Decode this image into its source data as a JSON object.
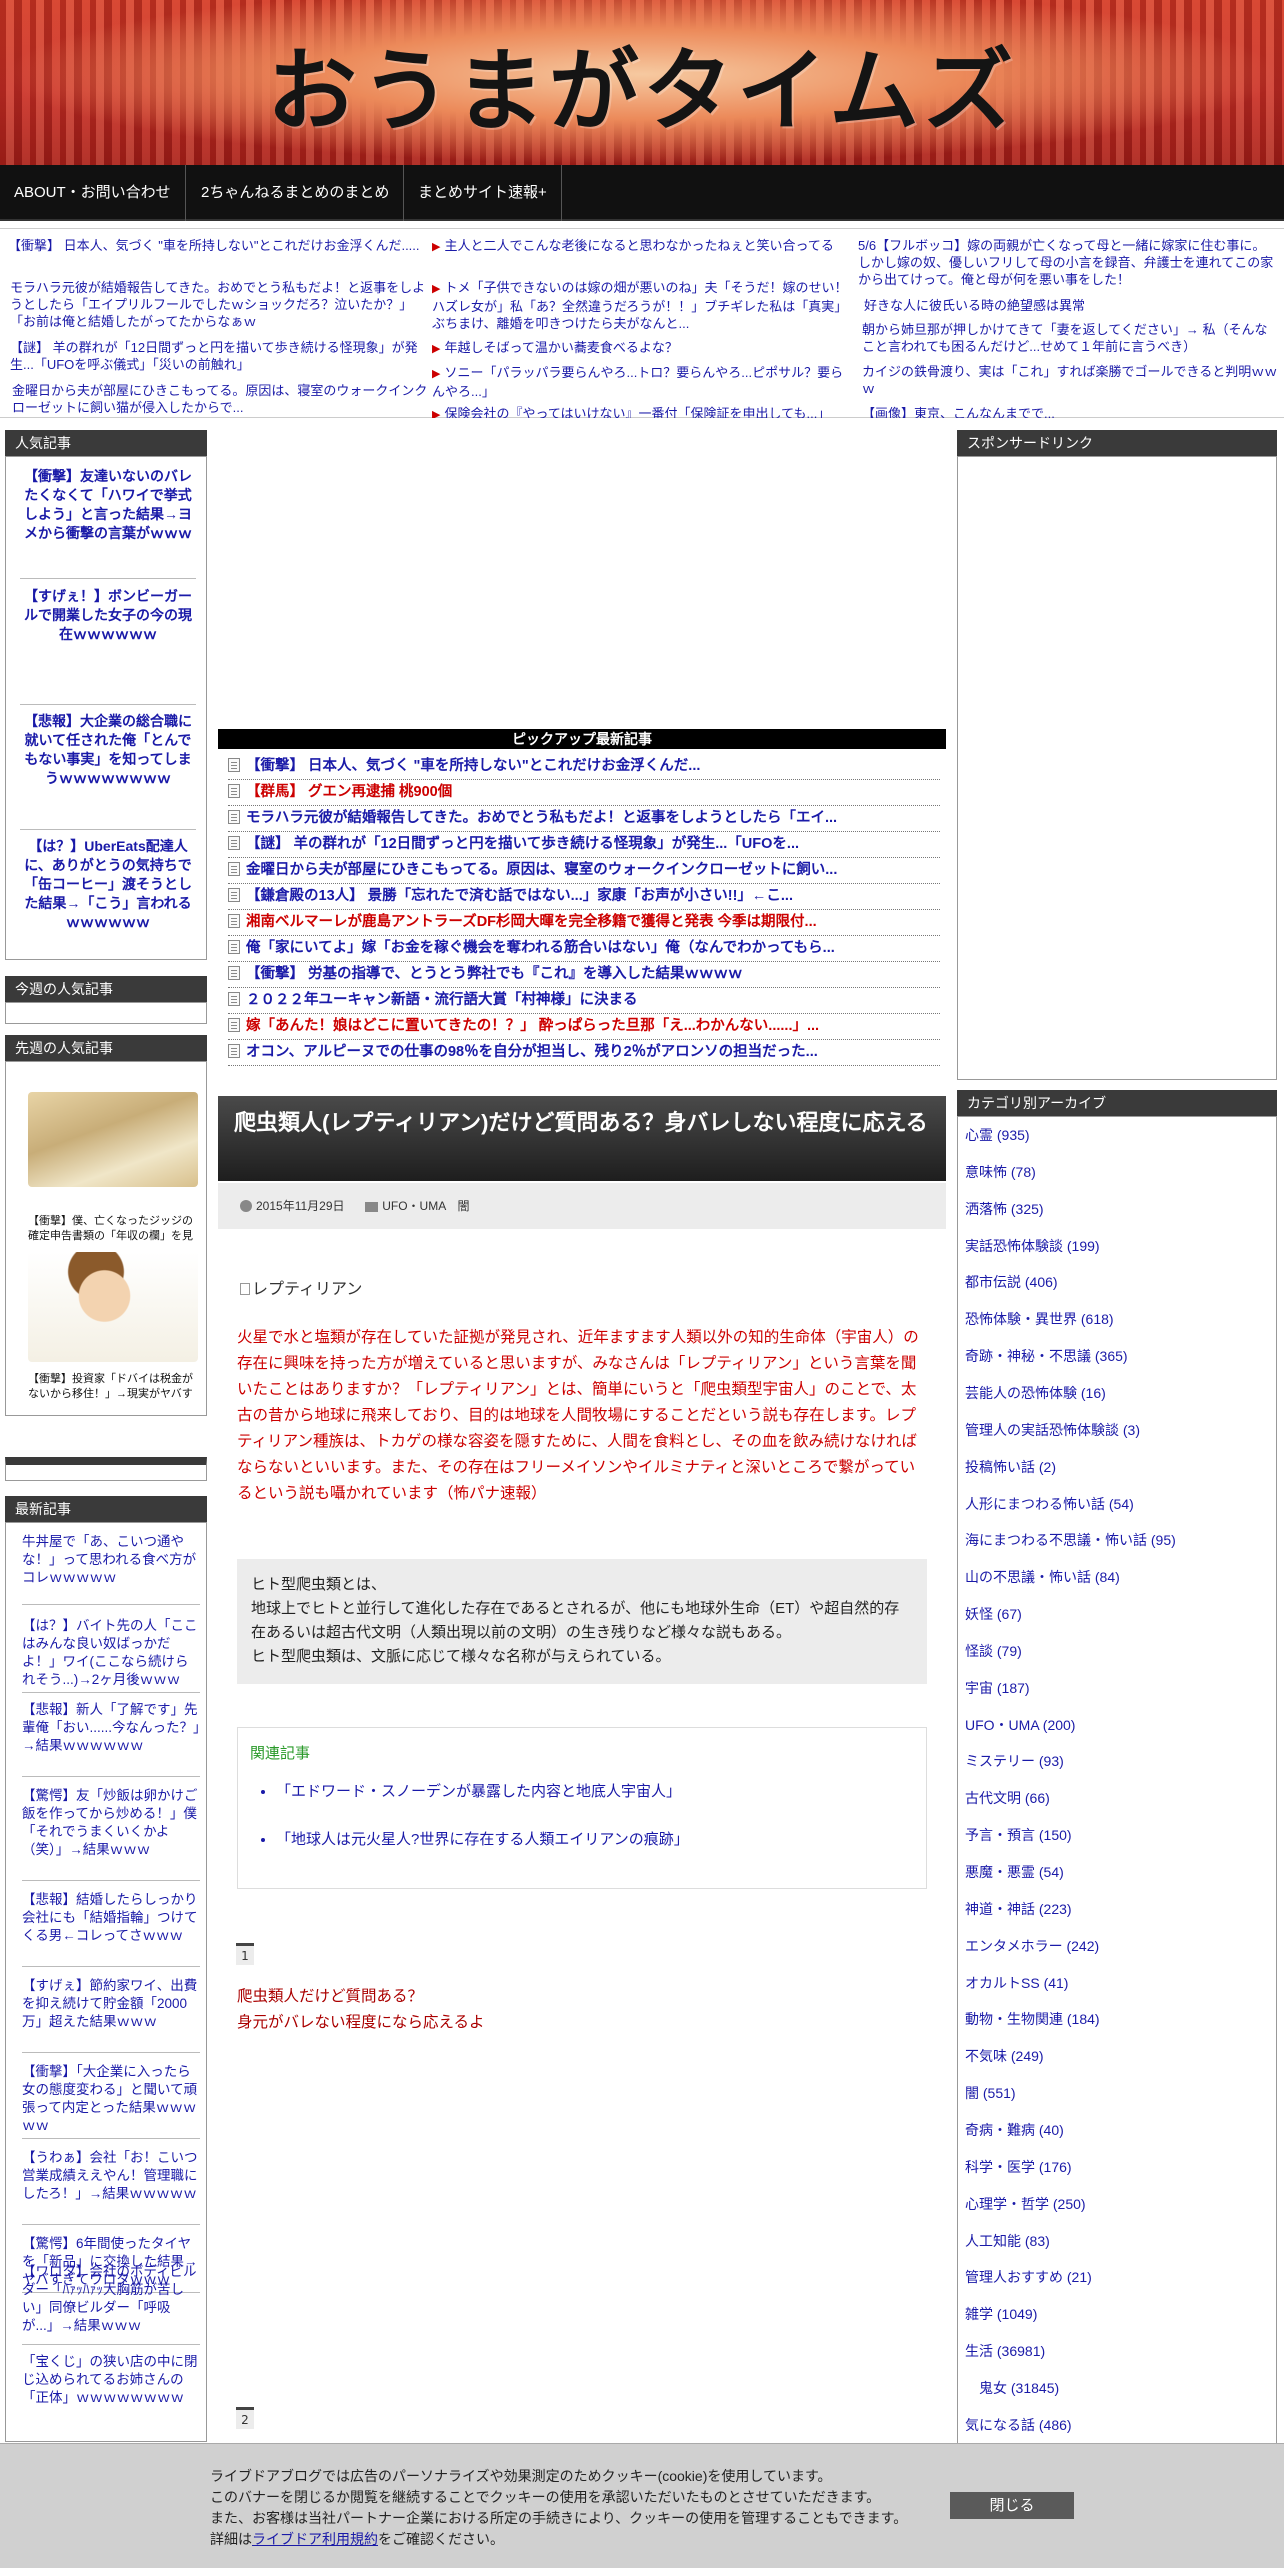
{
  "site": {
    "title": "おうまがタイムズ"
  },
  "nav": [
    "ABOUT・お問い合わせ",
    "2ちゃんねるまとめのまとめ",
    "まとめサイト速報+"
  ],
  "ticker": {
    "col1": [
      "【衝撃】 日本人、気づく \"車を所持しない\"とこれだけお金浮くんだ.....",
      "モラハラ元彼が結婚報告してきた。おめでとう私もだよ！と返事をしようとしたら「エイプリルフールでしたｗショックだろ？泣いたか？」「お前は俺と結婚したがってたからなぁｗ",
      "【謎】 羊の群れが「12日間ずっと円を描いて歩き続ける怪現象」が発生...「UFOを呼ぶ儀式」「災いの前触れ」",
      "金曜日から夫が部屋にひきこもってる。原因は、寝室のウォークインクローゼットに飼い猫が侵入したからで..."
    ],
    "col2": [
      "主人と二人でこんな老後になると思わなかったねぇと笑い合ってる",
      "トメ「子供できないのは嫁の畑が悪いのね」夫「そうだ！嫁のせい！ハズレ女が」私「あ？全然違うだろうが！！」ブチギレた私は「真実」ぶちまけ、離婚を叩きつけたら夫がなんと...",
      "年越しそばって温かい蕎麦食べるよな？",
      "ソニー「パラッパラ要らんやろ...トロ？要らんやろ...ピポサル？要らんやろ...」",
      "保険会社の『やってはいけない』一番付「保険証を申出しても...」"
    ],
    "col3": [
      "5/6【フルボッコ】嫁の両親が亡くなって母と一緒に嫁家に住む事に。しかし嫁の奴、優しいフリして母の小言を録音、弁護士を連れてこの家から出てけって。俺と母が何を悪い事をした！",
      "好きな人に彼氏いる時の絶望感は異常",
      "朝から姉旦那が押しかけてきて「妻を返してください」→ 私（そんなこと言われても困るんだけど...せめて１年前に言うべき）",
      "カイジの鉄骨渡り、実は「これ」すれば楽勝でゴールできると判明ｗｗｗ",
      "【画像】東京、こんなんまでで..."
    ]
  },
  "left": {
    "popular_head": "人気記事",
    "popular": [
      "【衝撃】友達いないのバレたくなくて「ハワイで挙式しよう」と言った結果→ヨメから衝撃の言葉がｗｗｗ",
      "【すげぇ！】ボンビーガールで開業した女子の今の現在ｗｗｗｗｗｗ",
      "【悲報】大企業の総合職に就いて任された俺「とんでもない事実」を知ってしまうｗｗｗｗｗｗｗｗ",
      "【は？】UberEats配達人に、ありがとうの気持ちで「缶コーヒー」渡そうとした結果→「こう」言われるｗｗｗｗｗｗ"
    ],
    "weekly_head": "今週の人気記事",
    "lastweek_head": "先週の人気記事",
    "lastweek": [
      "【衝撃】僕、亡くなったジッジの確定申告書類の「年収の欄」を見てしまった結果ｗｗｗ",
      "【衝撃】投資家「ドバイは税金がないから移住！」→現実がヤバすぎる・・・"
    ],
    "latest_head": "最新記事",
    "latest": [
      "牛丼屋で「あ、こいつ通やな！」って思われる食べ方がコレｗｗｗｗｗ",
      "【は？】バイト先の人「ここはみんな良い奴ばっかだよ！」ワイ(ここなら続けられそう...)→2ヶ月後ｗｗｗ",
      "【悲報】新人「了解です」先輩俺「おい......今なんった？」→結果ｗｗｗｗｗｗ",
      "【驚愕】友「炒飯は卵かけご飯を作ってから炒める！」僕「それでうまくいくかよ（笑）」→結果ｗｗｗ",
      "【悲報】結婚したらしっかり会社にも「結婚指輪」つけてくる男←コレってさｗｗｗ",
      "【すげぇ】節約家ワイ、出費を抑え続けて貯金額「2000万」超えた結果ｗｗｗ",
      "【衝撃】「大企業に入ったら女の態度変わる」と聞いて頑張って内定とった結果ｗｗｗｗｗ",
      "【うわぁ】会社「お！こいつ営業成績ええやん！管理職にしたろ！」→結果ｗｗｗｗｗ",
      "【驚愕】6年間使ったタイヤを「新品」に交換した結果→ヤバすぎてワロタｗｗｗ",
      "【ワロタ】会社のボディビルダー「ﾊｧｯﾊｧｯ大胸筋が苦しい」同僚ビルダー「呼吸が...」→結果ｗｗｗ",
      "「宝くじ」の狭い店の中に閉じ込められてるお姉さんの「正体」ｗｗｗｗｗｗｗｗ"
    ]
  },
  "pickup": {
    "head": "ピックアップ最新記事",
    "items": [
      {
        "text": "【衝撃】 日本人、気づく \"車を所持しない\"とこれだけお金浮くんだ...",
        "red": false
      },
      {
        "text": "【群馬】 グエン再逮捕 桃900個",
        "red": true
      },
      {
        "text": "モラハラ元彼が結婚報告してきた。おめでとう私もだよ！と返事をしようとしたら「エイ...",
        "red": false
      },
      {
        "text": "【謎】 羊の群れが「12日間ずっと円を描いて歩き続ける怪現象」が発生...「UFOを...",
        "red": false
      },
      {
        "text": "金曜日から夫が部屋にひきこもってる。原因は、寝室のウォークインクローゼットに飼い...",
        "red": false
      },
      {
        "text": "【鎌倉殿の13人】 景勝「忘れたで済む話ではない...」家康「お声が小さい!!」←こ...",
        "red": false
      },
      {
        "text": "湘南ベルマーレが鹿島アントラーズDF杉岡大暉を完全移籍で獲得と発表 今季は期限付...",
        "red": true
      },
      {
        "text": "俺「家にいてよ」嫁「お金を稼ぐ機会を奪われる筋合いはない」俺（なんでわかってもら...",
        "red": false
      },
      {
        "text": "【衝撃】 労基の指導で、とうとう弊社でも『これ』を導入した結果ｗｗｗｗ",
        "red": false
      },
      {
        "text": "２０２２年ユーキャン新語・流行語大賞「村神様」に決まる",
        "red": false
      },
      {
        "text": "嫁「あんた！娘はどこに置いてきたの！？」 酔っぱらった旦那「え...わかんない......」...",
        "red": true
      },
      {
        "text": "オコン、アルピーヌでの仕事の98％を自分が担当し、残り2％がアロンソの担当だった...",
        "red": false
      }
    ]
  },
  "article": {
    "title": "爬虫類人(レプティリアン)だけど質問ある？身バレしない程度に応える",
    "date": "2015年11月29日",
    "categories": "UFO・UMA　闇",
    "image_alt": "レプティリアン",
    "intro": "火星で水と塩類が存在していた証拠が発見され、近年ますます人類以外の知的生命体（宇宙人）の存在に興味を持った方が増えていると思いますが、みなさんは「レプティリアン」という言葉を聞いたことはありますか？「レプティリアン」とは、簡単にいうと「爬虫類型宇宙人」のことで、太古の昔から地球に飛来しており、目的は地球を人間牧場にすることだという説も存在します。レプティリアン種族は、トカゲの様な容姿を隠すために、人間を食料とし、その血を飲み続けなければならないといいます。また、その存在はフリーメイソンやイルミナティと深いところで繋がっているという説も囁かれています（怖パナ速報）",
    "definition": [
      "ヒト型爬虫類とは、",
      "地球上でヒトと並行して進化した存在であるとされるが、他にも地球外生命（ET）や超自然的存在あるいは超古代文明（人類出現以前の文明）の生き残りなど様々な説もある。",
      "ヒト型爬虫類は、文脈に応じて様々な名称が与えられている。"
    ],
    "related_label": "関連記事",
    "related": [
      "「エドワード・スノーデンが暴露した内容と地底人宇宙人」",
      "「地球人は元火星人?世界に存在する人類エイリアンの痕跡」"
    ],
    "post1_num": "1",
    "post1": [
      "爬虫類人だけど質問ある？",
      "身元がバレない程度になら応えるよ"
    ],
    "post2_num": "2"
  },
  "right": {
    "sponsor_head": "スポンサードリンク",
    "cat_head": "カテゴリ別アーカイブ",
    "categories": [
      "心霊 (935)",
      "意味怖 (78)",
      "洒落怖 (325)",
      "実話恐怖体験談 (199)",
      "都市伝説 (406)",
      "恐怖体験・異世界 (618)",
      "奇跡・神秘・不思議 (365)",
      "芸能人の恐怖体験 (16)",
      "管理人の実話恐怖体験談 (3)",
      "投稿怖い話 (2)",
      "人形にまつわる怖い話 (54)",
      "海にまつわる不思議・怖い話 (95)",
      "山の不思議・怖い話 (84)",
      "妖怪 (67)",
      "怪談 (79)",
      "宇宙 (187)",
      "UFO・UMA (200)",
      "ミステリー (93)",
      "古代文明 (66)",
      "予言・預言 (150)",
      "悪魔・悪霊 (54)",
      "神道・神話 (223)",
      "エンタメホラー (242)",
      "オカルトSS (41)",
      "動物・生物関連 (184)",
      "不気味 (249)",
      "闇 (551)",
      "奇病・難病 (40)",
      "科学・医学 (176)",
      "心理学・哲学 (250)",
      "人工知能 (83)",
      "管理人おすすめ (21)",
      "雑学 (1049)",
      "生活 (36981)",
      "　鬼女 (31845)",
      "気になる話 (486)"
    ]
  },
  "cookie": {
    "lines": [
      "ライブドアブログでは広告のパーソナライズや効果測定のためクッキー(cookie)を使用しています。",
      "このバナーを閉じるか閲覧を継続することでクッキーの使用を承認いただいたものとさせていただきます。",
      "また、お客様は当社パートナー企業における所定の手続きにより、クッキーの使用を管理することもできます。"
    ],
    "detail_prefix": "詳細は",
    "detail_link": "ライブドア利用規約",
    "detail_suffix": "をご確認ください。",
    "close": "閉じる"
  }
}
